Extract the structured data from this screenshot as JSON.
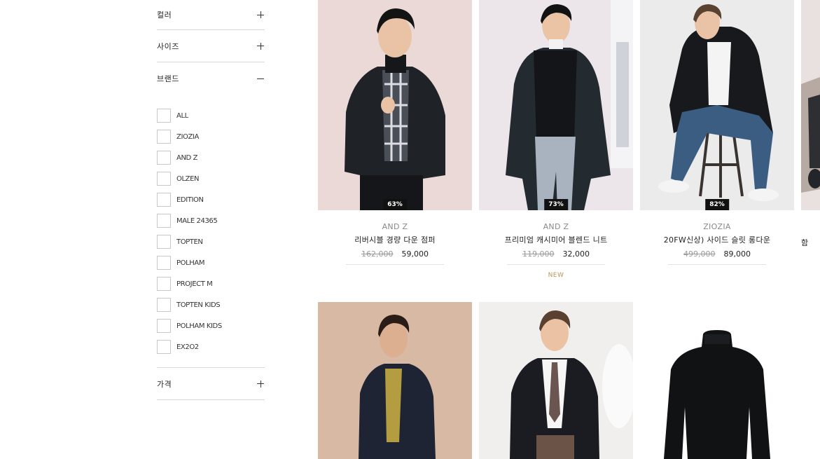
{
  "filters": {
    "color": {
      "title": "컬러"
    },
    "size": {
      "title": "사이즈"
    },
    "brand": {
      "title": "브랜드",
      "options": [
        "ALL",
        "ZIOZIA",
        "AND Z",
        "OLZEN",
        "EDITION",
        "MALE 24365",
        "TOPTEN",
        "POLHAM",
        "PROJECT M",
        "TOPTEN KIDS",
        "POLHAM KIDS",
        "EX2O2"
      ]
    },
    "price": {
      "title": "가격"
    }
  },
  "products": [
    {
      "brand": "AND Z",
      "name": "리버시블 경량 다운 점퍼",
      "original_price": "162,000",
      "sale_price": "59,000",
      "discount": "63%",
      "tag": ""
    },
    {
      "brand": "AND Z",
      "name": "프리미엄 캐시미어 블렌드 니트",
      "original_price": "119,000",
      "sale_price": "32,000",
      "discount": "73%",
      "tag": "NEW"
    },
    {
      "brand": "ZIOZIA",
      "name": "20FW신상) 사이드 슬릿 롱다운",
      "original_price": "499,000",
      "sale_price": "89,000",
      "discount": "82%",
      "tag": ""
    }
  ]
}
